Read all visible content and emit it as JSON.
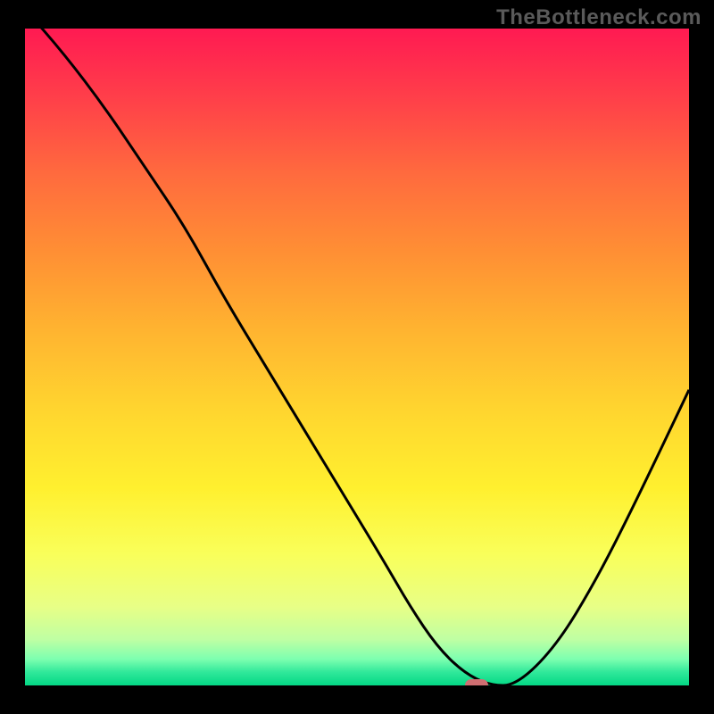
{
  "watermark": "TheBottleneck.com",
  "chart_data": {
    "type": "line",
    "title": "",
    "xlabel": "",
    "ylabel": "",
    "xlim": [
      0,
      100
    ],
    "ylim": [
      0,
      100
    ],
    "x": [
      0,
      6,
      12,
      18,
      24,
      30,
      36,
      42,
      48,
      54,
      58,
      62,
      66,
      70,
      74,
      80,
      86,
      92,
      100
    ],
    "values": [
      103,
      96,
      88,
      79,
      70,
      59,
      49,
      39,
      29,
      19,
      12,
      6,
      2,
      0,
      0,
      6,
      16,
      28,
      45
    ],
    "marker": {
      "x": 68,
      "y": 0
    },
    "gradient_note": "vertical red→yellow→green representing bottleneck severity"
  },
  "colors": {
    "curve": "#000000",
    "marker": "#cf6f72",
    "background_frame": "#000000"
  }
}
